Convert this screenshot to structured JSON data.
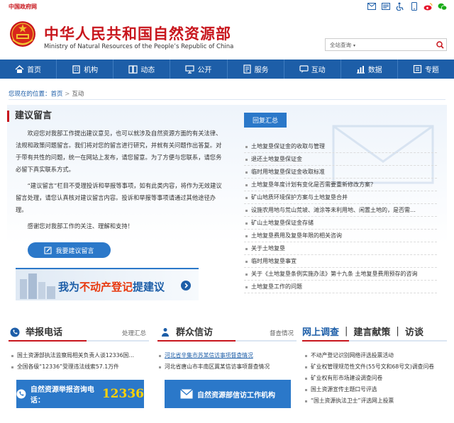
{
  "top": {
    "gov_link": "中国政府网",
    "icons": [
      "mail-icon",
      "message-icon",
      "accessibility-icon",
      "mobile-icon",
      "weibo-icon",
      "wechat-icon"
    ]
  },
  "header": {
    "title_cn": "中华人民共和国自然资源部",
    "title_en": "Ministry of Natural Resources of the People’s Republic of China",
    "search_scope": "全站查询"
  },
  "nav": [
    {
      "label": "首页",
      "icon": "home-icon"
    },
    {
      "label": "机构",
      "icon": "building-icon"
    },
    {
      "label": "动态",
      "icon": "book-icon"
    },
    {
      "label": "公开",
      "icon": "monitor-icon"
    },
    {
      "label": "服务",
      "icon": "document-icon"
    },
    {
      "label": "互动",
      "icon": "chat-icon"
    },
    {
      "label": "数据",
      "icon": "chart-icon"
    },
    {
      "label": "专题",
      "icon": "topic-icon"
    }
  ],
  "breadcrumb": {
    "prefix": "您现在的位置：",
    "home": "首页",
    "sep": ">",
    "current": "互动"
  },
  "suggest": {
    "title": "建议留言",
    "p1": "欢迎您对我部工作提出建议意见，也可以就涉及自然资源方面的有关法律、法规和政策问题留言。我们将对您的留言进行研究，并就有关问题作出答复。对于带有共性的问题，统一在网站上发布，请您留意。为了方便与您联系，请您务必留下真实联系方式。",
    "p2": "“建议留言”栏目不受理投诉和举报等事项，如有此类内容，将作为无效建议留言处理，请您认真核对建议留言内容。投诉和举报等事项请通过其他途径办理。",
    "p3": "感谢您对我部工作的关注、理解和支持！",
    "button": "我要建议留言",
    "banner_pre": "我为",
    "banner_hl": "不动产登记",
    "banner_post": "提建议"
  },
  "reply": {
    "tab": "回复汇总",
    "items": [
      "土地复垦保证金的收取与管理",
      "退还土地复垦保证金",
      "临时用地复垦保证金收取标准",
      "土地复垦年度计划有变化是否需要重新修改方案？",
      "矿山地质环境保护方案与土地复垦合并",
      "设施农用地与荒山荒坡、滩涂等未利用地、闲置土地的，是否需…",
      "矿山土地复垦保证金存储",
      "土地复垦费用及复垦年限的相关咨询",
      "关于土地复垦",
      "临时用地复垦事宜",
      "关于《土地复垦条例实施办法》第十九条 土地复垦费用预存的咨询",
      "土地复垦工作的问题"
    ]
  },
  "report": {
    "title": "举报电话",
    "more": "处理汇总",
    "items": [
      "国土资源部执法监察局相关负责人谈12336国…",
      "全国各级“12336”受理违法线索57.1万件"
    ],
    "button": "自然资源举报咨询电话：",
    "hotline": "12336"
  },
  "petition": {
    "title": "群众信访",
    "more": "督查情况",
    "items": [
      "河北省辛集市苏某信访事项督查情况",
      "河北省唐山市丰南区冀某信访事项督查情况"
    ],
    "button": "自然资源部信访工作机构"
  },
  "survey": {
    "tabs": [
      "网上调查",
      "建言献策",
      "访谈"
    ],
    "items": [
      "不动产登记识别网络评选投票活动",
      "矿业权管理规范性文件(55号文和68号文)调查问卷",
      "矿业权有形市场建设调查问卷",
      "国土资源宣传主题口号评选",
      "“国土资源执法卫士”评选网上投票"
    ]
  }
}
